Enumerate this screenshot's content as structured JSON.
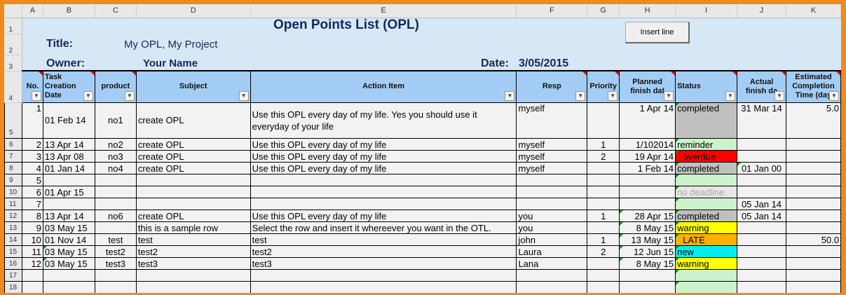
{
  "columns": [
    "A",
    "B",
    "C",
    "D",
    "E",
    "F",
    "G",
    "H",
    "I",
    "J",
    "K"
  ],
  "banner": {
    "heading": "Open Points List (OPL)",
    "title_label": "Title:",
    "title_value": "My OPL, My Project",
    "owner_label": "Owner:",
    "owner_value": "Your Name",
    "date_label": "Date:",
    "date_value": "3/05/2015",
    "insert_button": "Insert line"
  },
  "headers": [
    "No.",
    "Task Creation Date",
    "product",
    "Subject",
    "Action Item",
    "Resp",
    "Priority",
    "Planned finish dat",
    "Status",
    "Actual finish da",
    "Estimated Completion Time (day"
  ],
  "status_colors": {
    "completed": "#c0c0c0",
    "reminder": "#ccf2cc",
    "overdue": "#ff0000",
    "no deadline": "#e6e6e6",
    "warning": "#ffff00",
    "LATE": "#ffb000",
    "new": "#00eeee",
    "": "#ccf2cc"
  },
  "rows": [
    {
      "row": "5",
      "no": "1",
      "date": "01 Feb 14",
      "product": "no1",
      "subject": "create OPL",
      "action": "Use this OPL every day of my life. Yes you should use it everyday of your life",
      "resp": "myself",
      "priority": "",
      "planned": "1 Apr 14",
      "status": "completed",
      "actual": "31 Mar 14",
      "est": "5.0"
    },
    {
      "row": "6",
      "no": "2",
      "date": "13 Apr 14",
      "product": "no2",
      "subject": "create OPL",
      "action": "Use this OPL every day of my life",
      "resp": "myself",
      "priority": "1",
      "planned": "1/102014",
      "status": "reminder",
      "actual": "",
      "est": ""
    },
    {
      "row": "7",
      "no": "3",
      "date": "13 Apr 08",
      "product": "no3",
      "subject": "create OPL",
      "action": "Use this OPL every day of my life",
      "resp": "myself",
      "priority": "2",
      "planned": "19 Apr 14",
      "status": "overdue",
      "actual": "",
      "est": ""
    },
    {
      "row": "8",
      "no": "4",
      "date": "01 Jan 14",
      "product": "no4",
      "subject": "create OPL",
      "action": "Use this OPL every day of my life",
      "resp": "myself",
      "priority": "",
      "planned": "1 Feb 14",
      "status": "completed",
      "actual": "01 Jan 00",
      "est": ""
    },
    {
      "row": "9",
      "no": "5",
      "date": "",
      "product": "",
      "subject": "",
      "action": "",
      "resp": "",
      "priority": "",
      "planned": "",
      "status": "",
      "actual": "",
      "est": ""
    },
    {
      "row": "10",
      "no": "6",
      "date": "01 Apr 15",
      "product": "",
      "subject": "",
      "action": "",
      "resp": "",
      "priority": "",
      "planned": "",
      "status": "no deadline",
      "actual": "",
      "est": ""
    },
    {
      "row": "11",
      "no": "7",
      "date": "",
      "product": "",
      "subject": "",
      "action": "",
      "resp": "",
      "priority": "",
      "planned": "",
      "status": "",
      "actual": "05 Jan 14",
      "est": ""
    },
    {
      "row": "12",
      "no": "8",
      "date": "13 Apr 14",
      "product": "no6",
      "subject": "create OPL",
      "action": "Use this OPL every day of my life",
      "resp": "you",
      "priority": "1",
      "planned": "28 Apr 15",
      "status": "completed",
      "actual": "05 Jan 14",
      "est": ""
    },
    {
      "row": "13",
      "no": "9",
      "date": "03 May 15",
      "product": "",
      "subject": "this is a sample row",
      "action": "Select the row and insert it whereever you want in the OTL.",
      "resp": "you",
      "priority": "",
      "planned": "8 May 15",
      "status": "warning",
      "actual": "",
      "est": ""
    },
    {
      "row": "14",
      "no": "10",
      "date": "01 Nov 14",
      "product": "test",
      "subject": "test",
      "action": "test",
      "resp": "john",
      "priority": "1",
      "planned": "13 May 15",
      "status": "LATE",
      "actual": "",
      "est": "50.0"
    },
    {
      "row": "15",
      "no": "11",
      "date": "03 May 15",
      "product": "test2",
      "subject": "test2",
      "action": "test2",
      "resp": "Laura",
      "priority": "2",
      "planned": "12 Jun 15",
      "status": "new",
      "actual": "",
      "est": ""
    },
    {
      "row": "16",
      "no": "12",
      "date": "03 May 15",
      "product": "test3",
      "subject": "test3",
      "action": "test3",
      "resp": "Lana",
      "priority": "",
      "planned": "8 May 15",
      "status": "warning",
      "actual": "",
      "est": ""
    },
    {
      "row": "17",
      "no": "",
      "date": "",
      "product": "",
      "subject": "",
      "action": "",
      "resp": "",
      "priority": "",
      "planned": "",
      "status": "",
      "actual": "",
      "est": ""
    },
    {
      "row": "18",
      "no": "",
      "date": "",
      "product": "",
      "subject": "",
      "action": "",
      "resp": "",
      "priority": "",
      "planned": "",
      "status": "",
      "actual": "",
      "est": ""
    }
  ],
  "row_labels": [
    "1",
    "2",
    "3",
    "4"
  ]
}
